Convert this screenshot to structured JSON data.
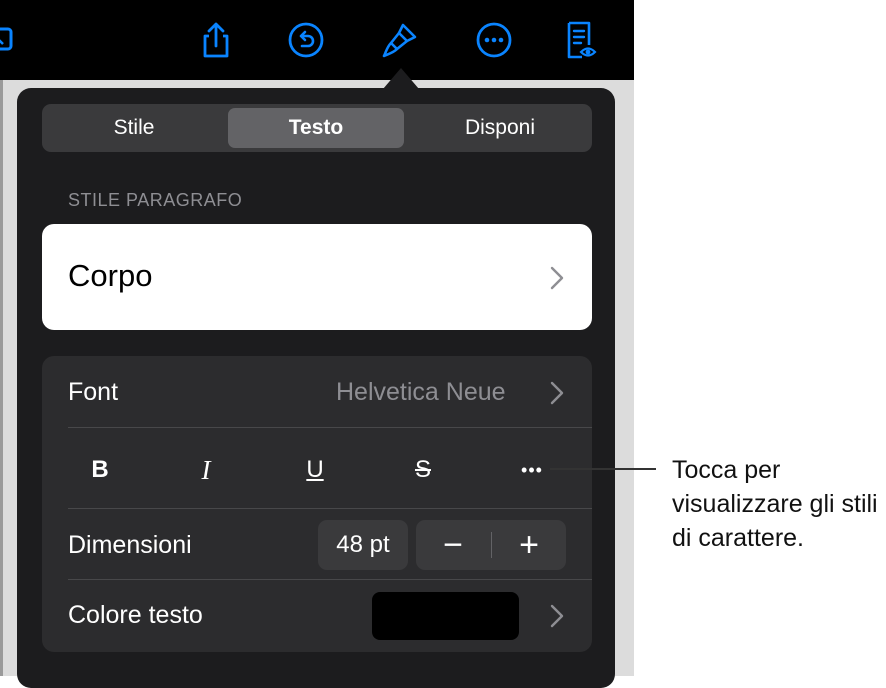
{
  "toolbar": {
    "icons": [
      "media-icon",
      "share-icon",
      "undo-icon",
      "format-brush-icon",
      "more-icon",
      "reader-view-icon"
    ]
  },
  "tabs": [
    {
      "label": "Stile",
      "active": false
    },
    {
      "label": "Testo",
      "active": true
    },
    {
      "label": "Disponi",
      "active": false
    }
  ],
  "paragraph_style": {
    "section_title": "STILE PARAGRAFO",
    "value": "Corpo"
  },
  "font": {
    "label": "Font",
    "value": "Helvetica Neue"
  },
  "format_buttons": {
    "bold": "B",
    "italic": "I",
    "underline": "U",
    "strikethrough": "S",
    "more": "•••"
  },
  "size": {
    "label": "Dimensioni",
    "value": "48 pt",
    "decrement": "−",
    "increment": "+"
  },
  "text_color": {
    "label": "Colore testo",
    "color": "#000000"
  },
  "callout": {
    "text": "Tocca per visualizzare gli stili di carattere."
  },
  "colors": {
    "accent": "#0a84ff",
    "popover_bg": "#1c1c1e",
    "group_bg": "#2c2c2e"
  }
}
